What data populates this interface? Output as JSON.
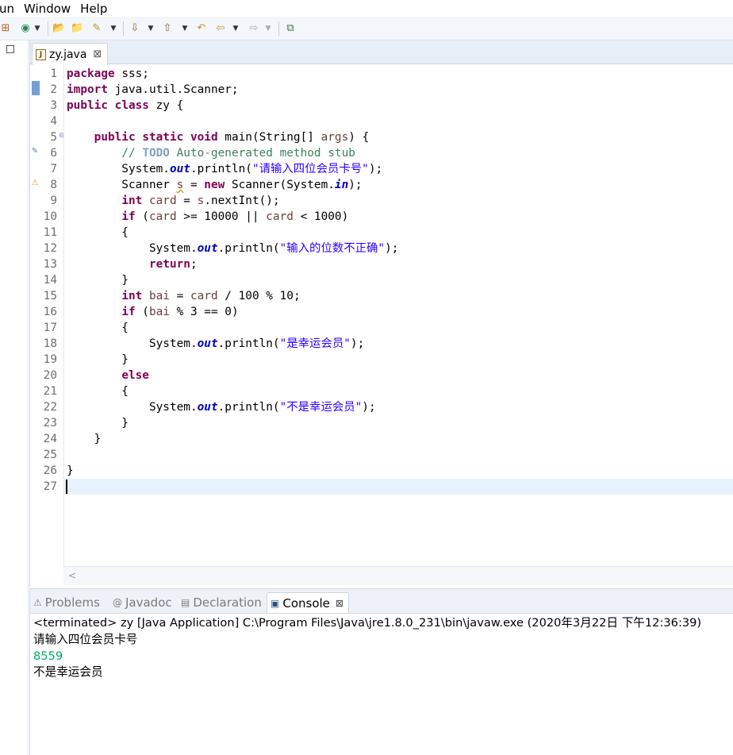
{
  "menu": {
    "items": [
      "un",
      "Window",
      "Help"
    ]
  },
  "toolbar": {
    "icons": [
      "new-package-icon",
      "run-icon",
      "open-type-icon",
      "open-resource-icon",
      "search-icon",
      "next-annotation-icon",
      "previous-annotation-icon",
      "last-edit-icon",
      "back-icon",
      "forward-icon",
      "pin-editor-icon"
    ]
  },
  "editor": {
    "tab_label": "zy.java",
    "file_badge": "J",
    "line_numbers": [
      "1",
      "2",
      "3",
      "4",
      "5",
      "6",
      "7",
      "8",
      "9",
      "10",
      "11",
      "12",
      "13",
      "14",
      "15",
      "16",
      "17",
      "18",
      "19",
      "20",
      "21",
      "22",
      "23",
      "24",
      "25",
      "26",
      "27"
    ],
    "fold_marker": "⊖"
  },
  "colors": {
    "keyword": "#7f0055",
    "string": "#2a00ff",
    "comment": "#3f7f5f",
    "field": "#0000c0",
    "local_var": "#6a3e3e",
    "console_input": "#00aa66",
    "current_line": "#e8f2fe"
  },
  "console": {
    "tabs": [
      {
        "label": "Problems",
        "icon": "problems-icon"
      },
      {
        "label": "Javadoc",
        "icon": "javadoc-icon"
      },
      {
        "label": "Declaration",
        "icon": "declaration-icon"
      },
      {
        "label": "Console",
        "icon": "console-icon"
      }
    ],
    "status": "<terminated> zy [Java Application] C:\\Program Files\\Java\\jre1.8.0_231\\bin\\javaw.exe (2020年3月22日 下午12:36:39)",
    "output": [
      "请输入四位会员卡号",
      "8559",
      "不是幸运会员"
    ]
  }
}
